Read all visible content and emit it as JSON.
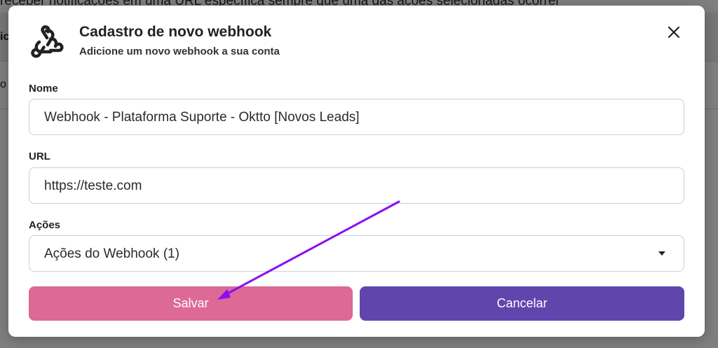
{
  "background": {
    "top_text": "receber notificações em uma URL específica sempre que uma das ações selecionadas ocorrer",
    "row1_text": "ic",
    "row2_text": "o"
  },
  "modal": {
    "title": "Cadastro de novo webhook",
    "subtitle": "Adicione um novo webhook a sua conta",
    "header_icon": "webhook-icon",
    "close_icon": "close-icon"
  },
  "form": {
    "name_label": "Nome",
    "name_value": "Webhook - Plataforma Suporte - Oktto [Novos Leads]",
    "url_label": "URL",
    "url_value": "https://teste.com",
    "actions_label": "Ações",
    "actions_value": "Ações do Webhook (1)",
    "actions_icon": "chevron-down-icon"
  },
  "buttons": {
    "save_label": "Salvar",
    "cancel_label": "Cancelar"
  },
  "colors": {
    "save": "#dc6996",
    "cancel": "#6045ad",
    "annotation_arrow": "#8a0ff0"
  }
}
